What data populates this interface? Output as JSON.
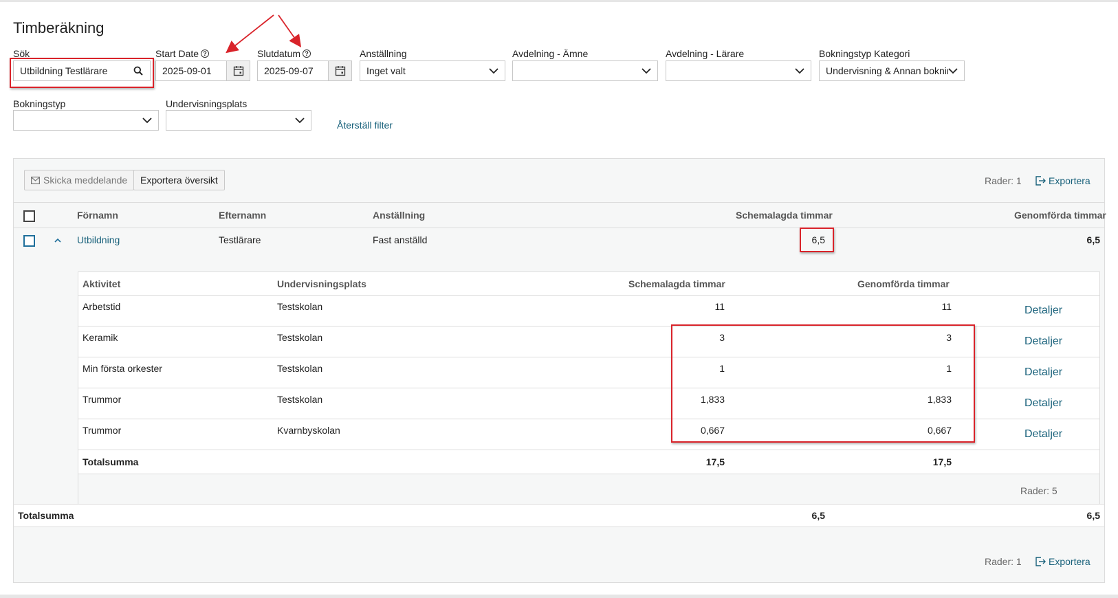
{
  "page_title": "Timberäkning",
  "filters": {
    "search": {
      "label": "Sök",
      "value": "Utbildning Testlärare"
    },
    "start_date": {
      "label": "Start Date",
      "value": "2025-09-01"
    },
    "end_date": {
      "label": "Slutdatum",
      "value": "2025-09-07"
    },
    "employment": {
      "label": "Anställning",
      "value": "Inget valt"
    },
    "dept_subject": {
      "label": "Avdelning - Ämne",
      "value": ""
    },
    "dept_teacher": {
      "label": "Avdelning - Lärare",
      "value": ""
    },
    "booking_category": {
      "label": "Bokningstyp Kategori",
      "value": "Undervisning & Annan bokning"
    },
    "booking_type": {
      "label": "Bokningstyp",
      "value": ""
    },
    "teaching_place": {
      "label": "Undervisningsplats",
      "value": ""
    },
    "reset_label": "Återställ filter"
  },
  "toolbar": {
    "send_message": "Skicka meddelande",
    "export_overview": "Exportera översikt",
    "rows_top": "Rader: 1",
    "export_top": "Exportera"
  },
  "table": {
    "headers": {
      "first_name": "Förnamn",
      "last_name": "Efternamn",
      "employment": "Anställning",
      "scheduled": "Schemalagda timmar",
      "completed": "Genomförda timmar"
    },
    "row": {
      "first_name": "Utbildning",
      "last_name": "Testlärare",
      "employment": "Fast anställd",
      "scheduled": "6,5",
      "completed": "6,5"
    },
    "total": {
      "label": "Totalsumma",
      "scheduled": "6,5",
      "completed": "6,5"
    },
    "rows_bottom": "Rader: 1",
    "export_bottom": "Exportera"
  },
  "detail_table": {
    "headers": {
      "activity": "Aktivitet",
      "place": "Undervisningsplats",
      "scheduled": "Schemalagda timmar",
      "completed": "Genomförda timmar"
    },
    "rows": [
      {
        "activity": "Arbetstid",
        "place": "Testskolan",
        "scheduled": "11",
        "completed": "11",
        "link": "Detaljer"
      },
      {
        "activity": "Keramik",
        "place": "Testskolan",
        "scheduled": "3",
        "completed": "3",
        "link": "Detaljer"
      },
      {
        "activity": "Min första orkester",
        "place": "Testskolan",
        "scheduled": "1",
        "completed": "1",
        "link": "Detaljer"
      },
      {
        "activity": "Trummor",
        "place": "Testskolan",
        "scheduled": "1,833",
        "completed": "1,833",
        "link": "Detaljer"
      },
      {
        "activity": "Trummor",
        "place": "Kvarnbyskolan",
        "scheduled": "0,667",
        "completed": "0,667",
        "link": "Detaljer"
      }
    ],
    "total": {
      "label": "Totalsumma",
      "scheduled": "17,5",
      "completed": "17,5"
    },
    "rows_count": "Rader: 5"
  },
  "colors": {
    "link": "#17607a",
    "highlight": "#d9232a"
  }
}
